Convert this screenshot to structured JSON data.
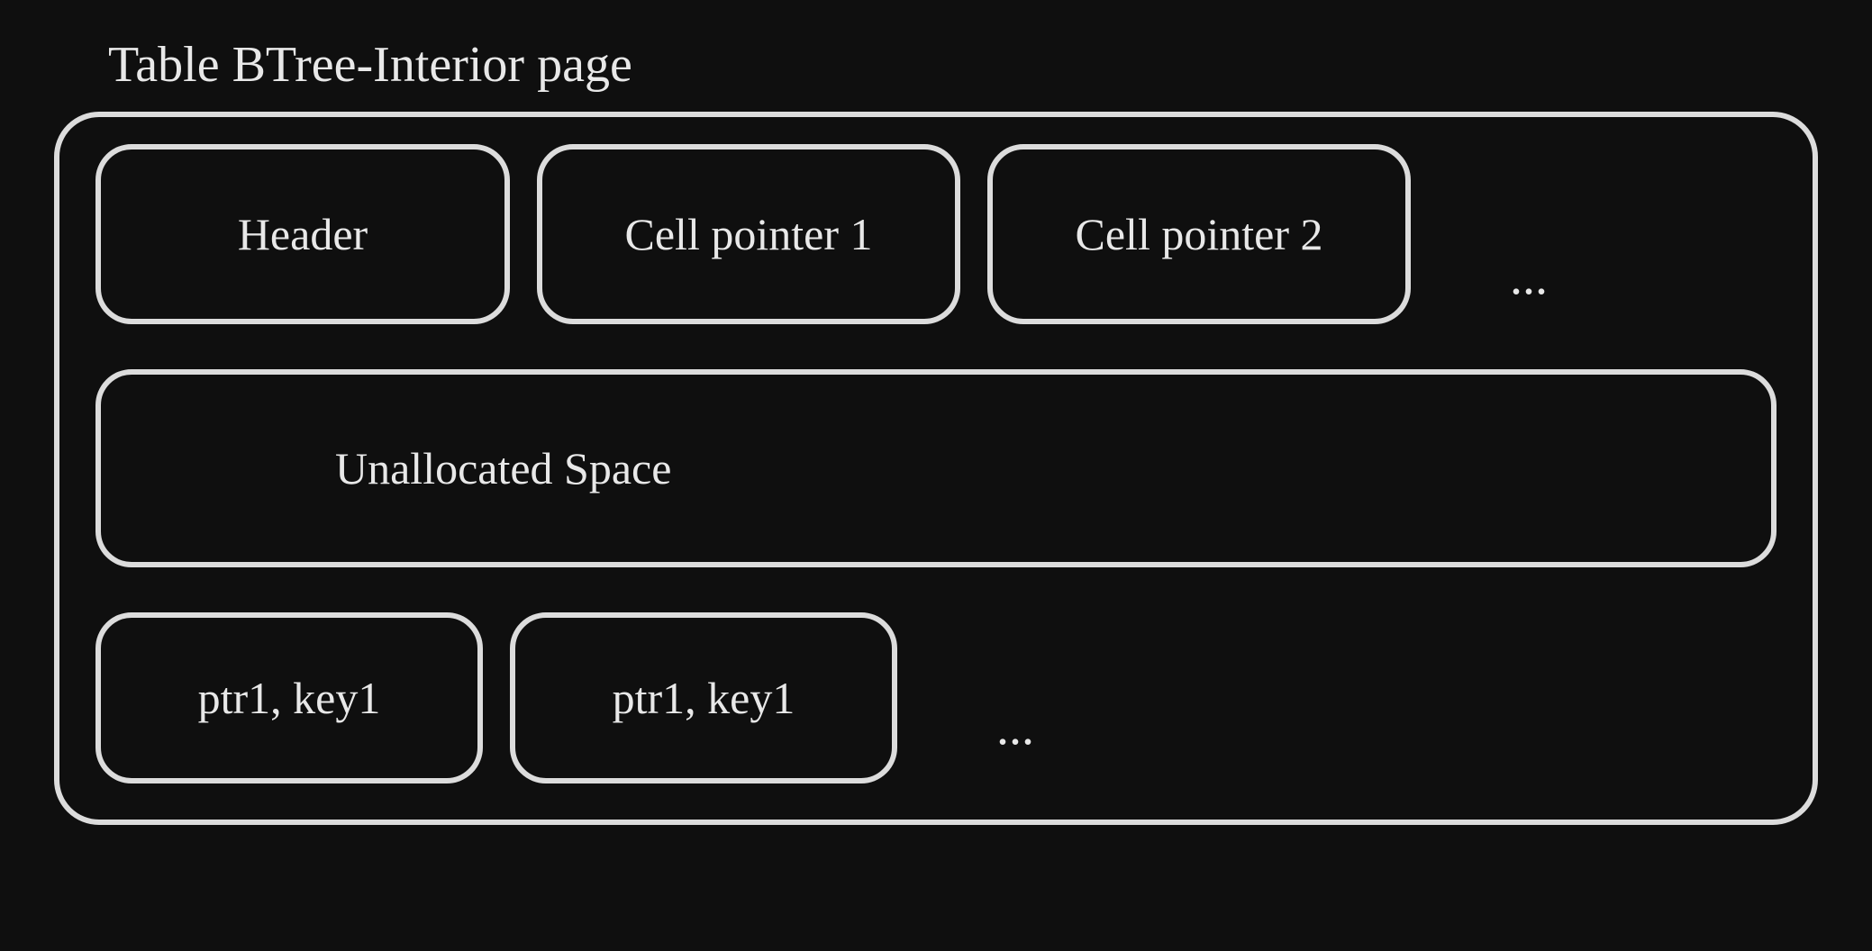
{
  "diagram": {
    "title": "Table BTree-Interior page",
    "topRow": {
      "header": "Header",
      "cellPointer1": "Cell pointer 1",
      "cellPointer2": "Cell pointer 2",
      "ellipsis": "..."
    },
    "middle": {
      "unallocated": "Unallocated Space"
    },
    "bottomRow": {
      "cell1": "ptr1, key1",
      "cell2": "ptr1, key1",
      "ellipsis": "..."
    }
  }
}
